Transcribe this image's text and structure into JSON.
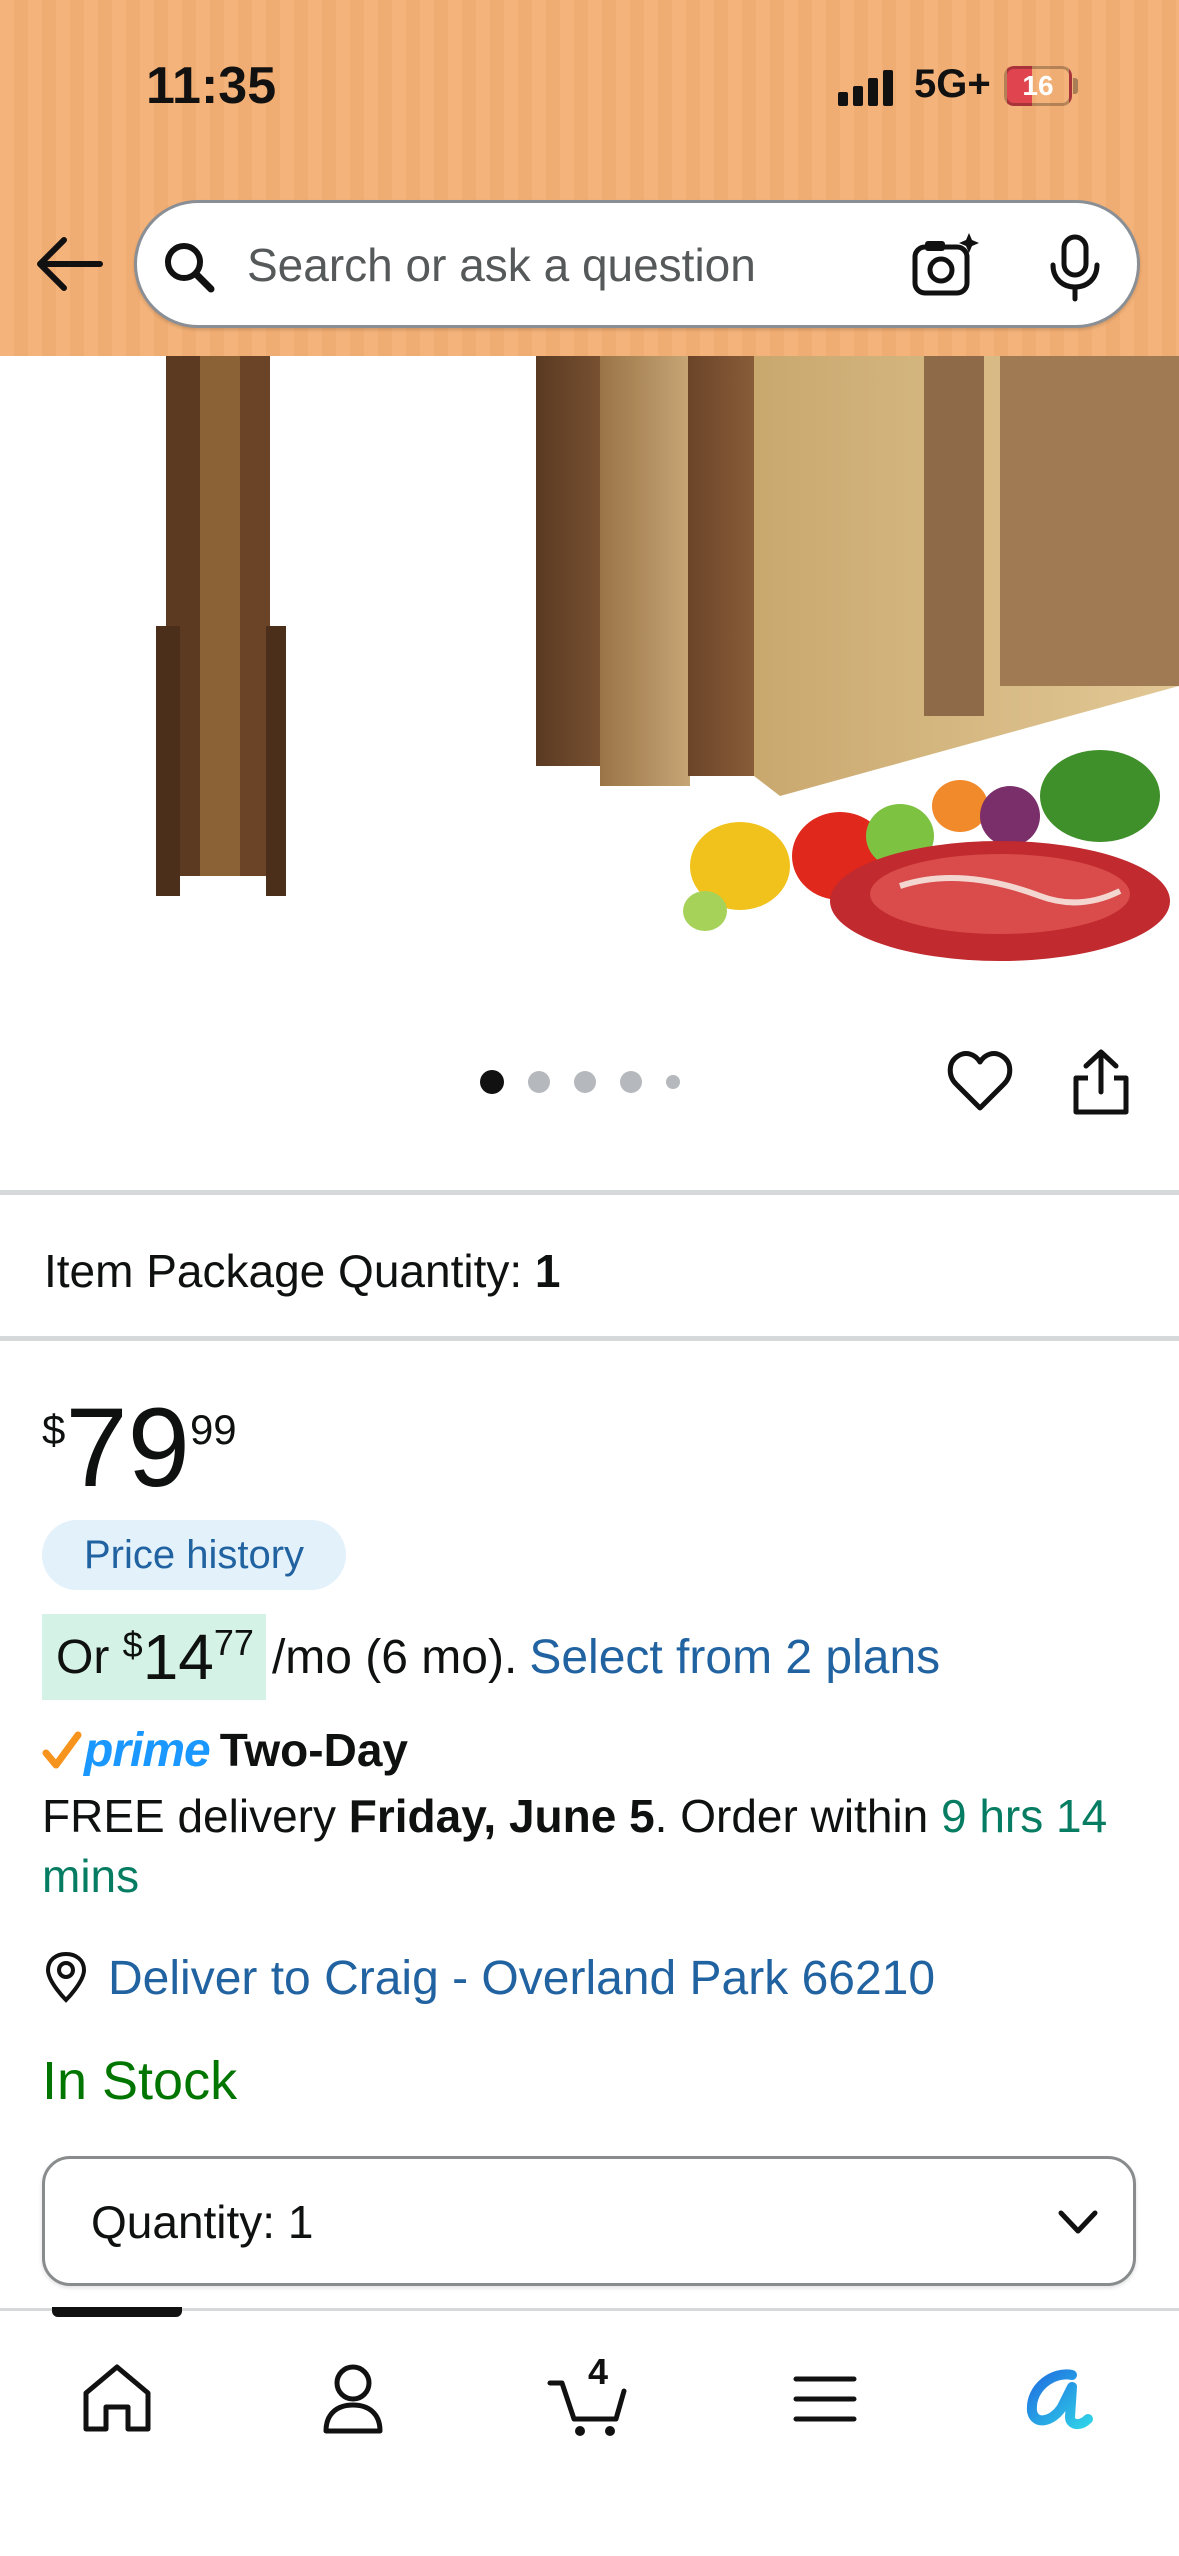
{
  "status_bar": {
    "time": "11:35",
    "network": "5G+",
    "battery": "16"
  },
  "search": {
    "placeholder": "Search or ask a question"
  },
  "gallery": {
    "image_count": 5,
    "active_index": 0
  },
  "package_quantity": {
    "label": "Item Package Quantity:",
    "value": "1"
  },
  "price": {
    "currency": "$",
    "whole": "79",
    "fraction": "99"
  },
  "price_history_label": "Price history",
  "monthly": {
    "prefix": "Or",
    "currency": "$",
    "whole": "14",
    "fraction": "77",
    "suffix": "/mo (6 mo).",
    "plans_link": "Select from 2 plans"
  },
  "prime": {
    "brand": "prime",
    "speed": "Two-Day"
  },
  "delivery": {
    "prefix": "FREE delivery",
    "date": "Friday, June 5",
    "middle": ". Order within",
    "timer": "9 hrs 14 mins"
  },
  "deliver_to": "Deliver to Craig - Overland Park 66210",
  "stock_status": "In Stock",
  "quantity_selector": {
    "label": "Quantity:",
    "value": "1"
  },
  "bottom_nav": {
    "items": [
      "home-icon",
      "account-icon",
      "cart-icon",
      "menu-icon",
      "rufus-icon"
    ],
    "cart_count": "4",
    "active": "home"
  },
  "colors": {
    "header_bg": "#f3b37a",
    "link_blue": "#2162a1",
    "stock_green": "#007600",
    "timer_green": "#067d62",
    "prime_blue": "#1a98ff",
    "price_history_bg": "#e3f1fb",
    "monthly_pill_bg": "#d4f2e6"
  }
}
